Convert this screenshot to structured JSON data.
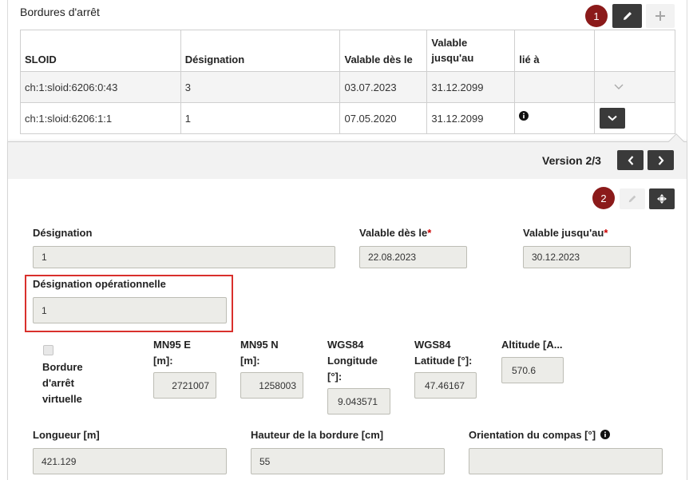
{
  "section": {
    "title": "Bordures d'arrêt"
  },
  "badges": {
    "one": "1",
    "two": "2"
  },
  "table": {
    "headers": {
      "sloid": "SLOID",
      "designation": "Désignation",
      "valid_from": "Valable dès le",
      "valid_to_line1": "Valable",
      "valid_to_line2": "jusqu'au",
      "linked": "lié à"
    },
    "rows": [
      {
        "sloid": "ch:1:sloid:6206:0:43",
        "designation": "3",
        "valid_from": "03.07.2023",
        "valid_to": "31.12.2099"
      },
      {
        "sloid": "ch:1:sloid:6206:1:1",
        "designation": "1",
        "valid_from": "07.05.2020",
        "valid_to": "31.12.2099"
      }
    ]
  },
  "detail": {
    "version_label": "Version 2/3",
    "designation": {
      "label": "Désignation",
      "value": "1"
    },
    "valid_from": {
      "label": "Valable dès le",
      "required": "*",
      "value": "22.08.2023"
    },
    "valid_to": {
      "label": "Valable jusqu'au",
      "required": "*",
      "value": "30.12.2023"
    },
    "operational_designation": {
      "label": "Désignation opérationnelle",
      "value": "1"
    },
    "virtual_border": {
      "label_line1": "Bordure",
      "label_line2": "d'arrêt",
      "label_line3": "virtuelle"
    },
    "mn95_e": {
      "label_line1": "MN95 E",
      "label_line2": "[m]:",
      "value": "2721007"
    },
    "mn95_n": {
      "label_line1": "MN95 N",
      "label_line2": "[m]:",
      "value": "1258003"
    },
    "wgs84_lon": {
      "label_line1": "WGS84",
      "label_line2": "Longitude",
      "label_line3": "[°]:",
      "value": "9.043571"
    },
    "wgs84_lat": {
      "label_line1": "WGS84",
      "label_line2": "Latitude [°]:",
      "value": "47.46167"
    },
    "altitude": {
      "label": "Altitude [A...",
      "value": "570.6"
    },
    "length": {
      "label": "Longueur [m]",
      "value": "421.129"
    },
    "border_height": {
      "label": "Hauteur de la bordure [cm]",
      "value": "55"
    },
    "compass": {
      "label": "Orientation du compas [°]",
      "value": ""
    }
  },
  "colors": {
    "badge": "#8b1a1a",
    "dark_button": "#3a3a3a",
    "highlight": "#d9302c",
    "required": "#cc0000"
  }
}
